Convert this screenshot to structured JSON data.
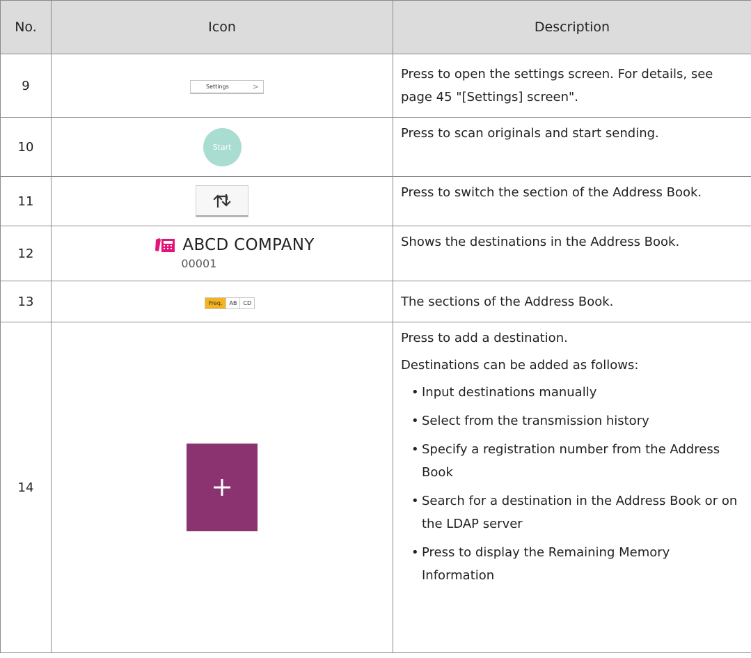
{
  "headers": {
    "no": "No.",
    "icon": "Icon",
    "description": "Description"
  },
  "rows": [
    {
      "no": "9",
      "icon": {
        "type": "settings-button",
        "label": "Settings",
        "chevron": ">"
      },
      "description": "Press to open the settings screen. For details, see page 45 \"[Settings] screen\"."
    },
    {
      "no": "10",
      "icon": {
        "type": "start-button",
        "label": "Start",
        "color": "#a9ddd2"
      },
      "description": "Press to scan originals and start sending."
    },
    {
      "no": "11",
      "icon": {
        "type": "switch-section-button",
        "icon_name": "swap-arrows-icon"
      },
      "description": "Press to switch the section of the Address Book."
    },
    {
      "no": "12",
      "icon": {
        "type": "address-book-entry",
        "icon_name": "fax-icon",
        "name": "ABCD COMPANY",
        "number": "00001",
        "icon_color": "#e3157a"
      },
      "description": "Shows the destinations in the Address Book."
    },
    {
      "no": "13",
      "icon": {
        "type": "section-tabs",
        "tabs": [
          "Freq.",
          "AB",
          "CD"
        ],
        "active_color": "#f3b41d"
      },
      "description": "The sections of the Address Book."
    },
    {
      "no": "14",
      "icon": {
        "type": "add-destination-button",
        "icon_name": "plus-icon",
        "color": "#8b3370"
      },
      "description": "Press to add a destination.",
      "description_intro": "Destinations can be added as follows:",
      "bullets": [
        "Input destinations manually",
        "Select from the transmission history",
        "Specify a registration number from the Address Book",
        "Search for a destination in the Address Book or on the LDAP server",
        "Press to display the Remaining Memory Information"
      ]
    }
  ]
}
